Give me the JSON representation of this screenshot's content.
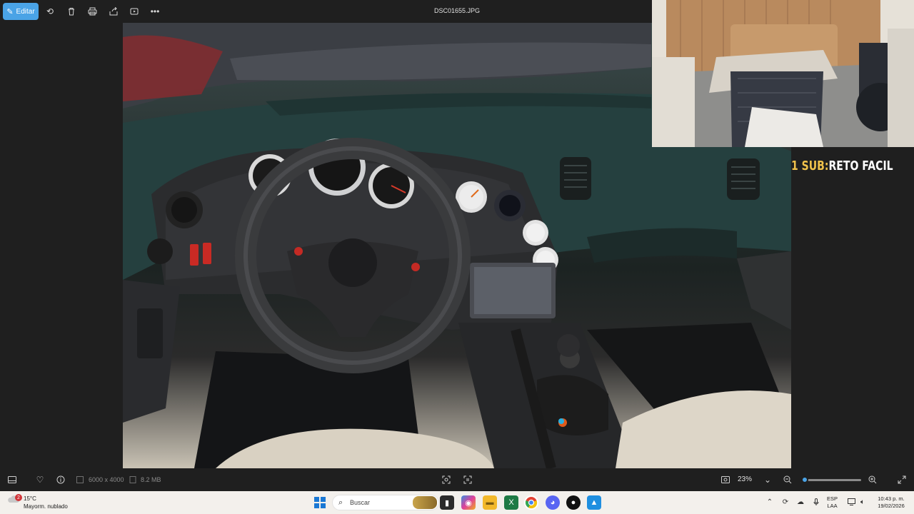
{
  "toolbar": {
    "edit_label": "Editar",
    "filename": "DSC01655.JPG"
  },
  "icons": {
    "edit": "pencil-edit-icon",
    "rotate": "rotate-icon",
    "delete": "trash-icon",
    "print": "print-icon",
    "share": "share-icon",
    "slideshow": "slideshow-icon",
    "more": "more-icon"
  },
  "overlay": {
    "sub_count": "1 SUB:",
    "challenge": "RETO FACIL"
  },
  "infobar": {
    "dimensions": "6000 x 4000",
    "filesize": "8.2 MB",
    "zoom": "23%",
    "zoom_fraction": 0.04
  },
  "taskbar": {
    "weather_badge": "2",
    "temperature": "15°C",
    "weather_desc": "Mayorm. nublado",
    "search_placeholder": "Buscar",
    "lang_top": "ESP",
    "lang_bottom": "LAA",
    "time": "10:43 p. m.",
    "date": "19/02/2026"
  },
  "colors": {
    "accent": "#4aa3e6",
    "overlay_sub": "#f0c24b",
    "dark_bg": "#1f1f1f",
    "taskbar_bg": "#f3f0ec"
  }
}
